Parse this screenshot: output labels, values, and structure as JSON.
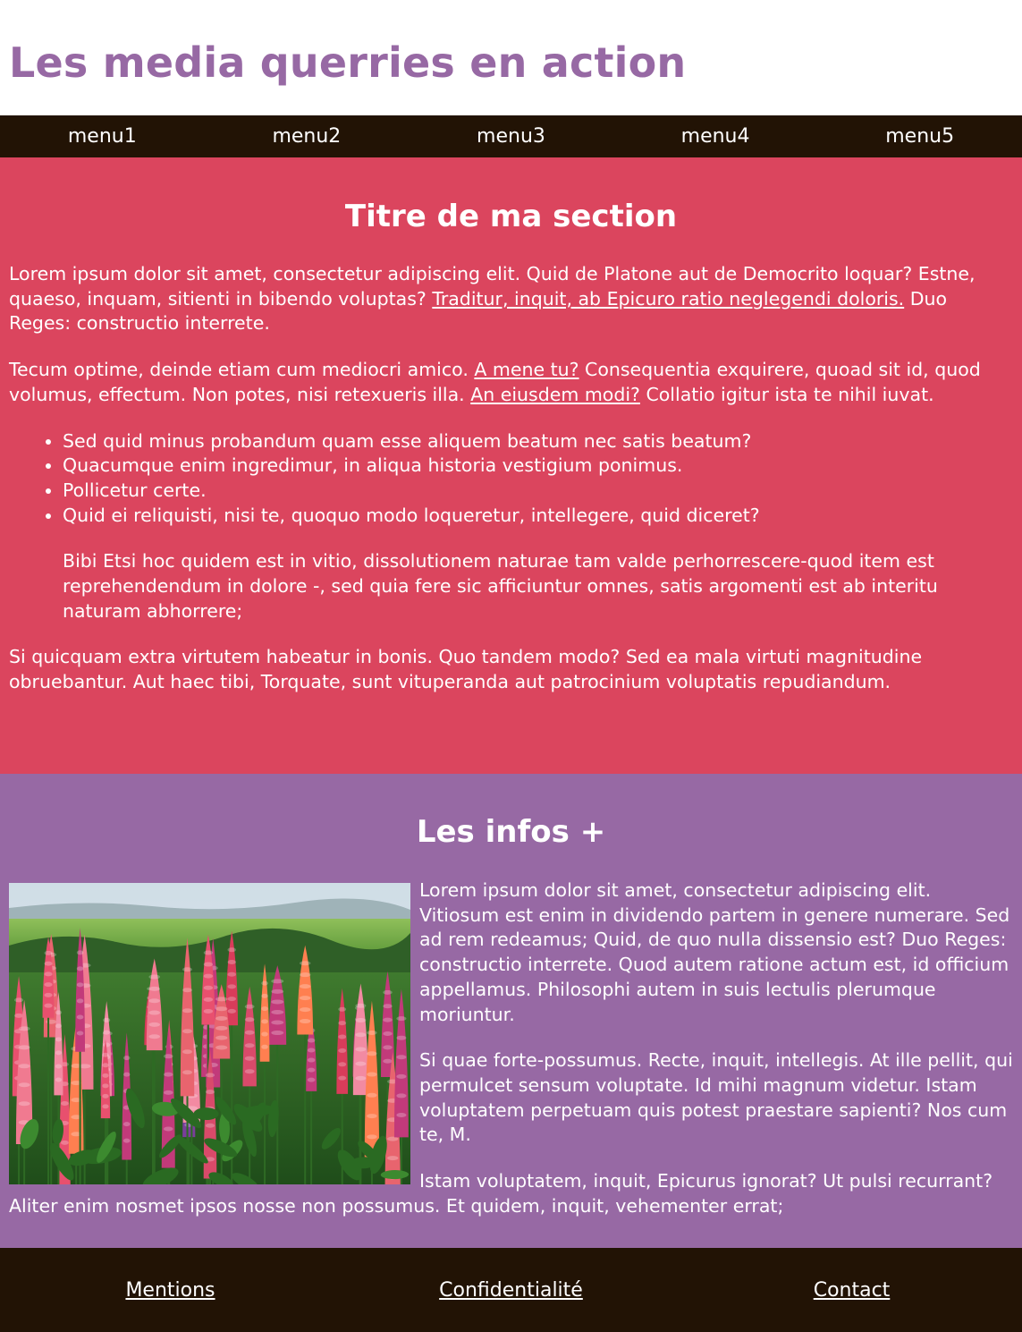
{
  "header": {
    "title": "Les media querries en action"
  },
  "nav": {
    "items": [
      "menu1",
      "menu2",
      "menu3",
      "menu4",
      "menu5"
    ]
  },
  "section": {
    "title": "Titre de ma section",
    "p1": {
      "before": "Lorem ipsum dolor sit amet, consectetur adipiscing elit. Quid de Platone aut de Democrito loquar? Estne, quaeso, inquam, sitienti in bibendo voluptas? ",
      "link": "Traditur, inquit, ab Epicuro ratio neglegendi doloris.",
      "after": " Duo Reges: constructio interrete."
    },
    "p2": {
      "before": "Tecum optime, deinde etiam cum mediocri amico. ",
      "link1": "A mene tu?",
      "middle": " Consequentia exquirere, quoad sit id, quod volumus, effectum. Non potes, nisi retexueris illa. ",
      "link2": "An eiusdem modi?",
      "after": " Collatio igitur ista te nihil iuvat."
    },
    "list": [
      "Sed quid minus probandum quam esse aliquem beatum nec satis beatum?",
      "Quacumque enim ingredimur, in aliqua historia vestigium ponimus.",
      "Pollicetur certe.",
      "Quid ei reliquisti, nisi te, quoquo modo loqueretur, intellegere, quid diceret?"
    ],
    "quote": "Bibi Etsi hoc quidem est in vitio, dissolutionem naturae tam valde perhorrescere-quod item est reprehendendum in dolore -, sed quia fere sic afficiuntur omnes, satis argomenti est ab interitu naturam abhorrere;",
    "p3": "Si quicquam extra virtutem habeatur in bonis. Quo tandem modo? Sed ea mala virtuti magnitudine obruebantur. Aut haec tibi, Torquate, sunt vituperanda aut patrocinium voluptatis repudiandum."
  },
  "infos": {
    "title": "Les infos +",
    "image": "lupine-flowers-photo",
    "p1": "Lorem ipsum dolor sit amet, consectetur adipiscing elit. Vitiosum est enim in dividendo partem in genere numerare. Sed ad rem redeamus; Quid, de quo nulla dissensio est? Duo Reges: constructio interrete. Quod autem ratione actum est, id officium appellamus. Philosophi autem in suis lectulis plerumque moriuntur.",
    "p2": "Si quae forte-possumus. Recte, inquit, intellegis. At ille pellit, qui permulcet sensum voluptate. Id mihi magnum videtur. Istam voluptatem perpetuam quis potest praestare sapienti? Nos cum te, M.",
    "p3": "Istam voluptatem, inquit, Epicurus ignorat? Ut pulsi recurrant? Aliter enim nosmet ipsos nosse non possumus. Et quidem, inquit, vehementer errat;"
  },
  "footer": {
    "links": [
      "Mentions",
      "Confidentialité",
      "Contact"
    ]
  },
  "colors": {
    "title": "#9769a4",
    "nav_bg": "#221305",
    "section_bg": "#db455e",
    "infos_bg": "#9769a4",
    "footer_bg": "#221305"
  }
}
